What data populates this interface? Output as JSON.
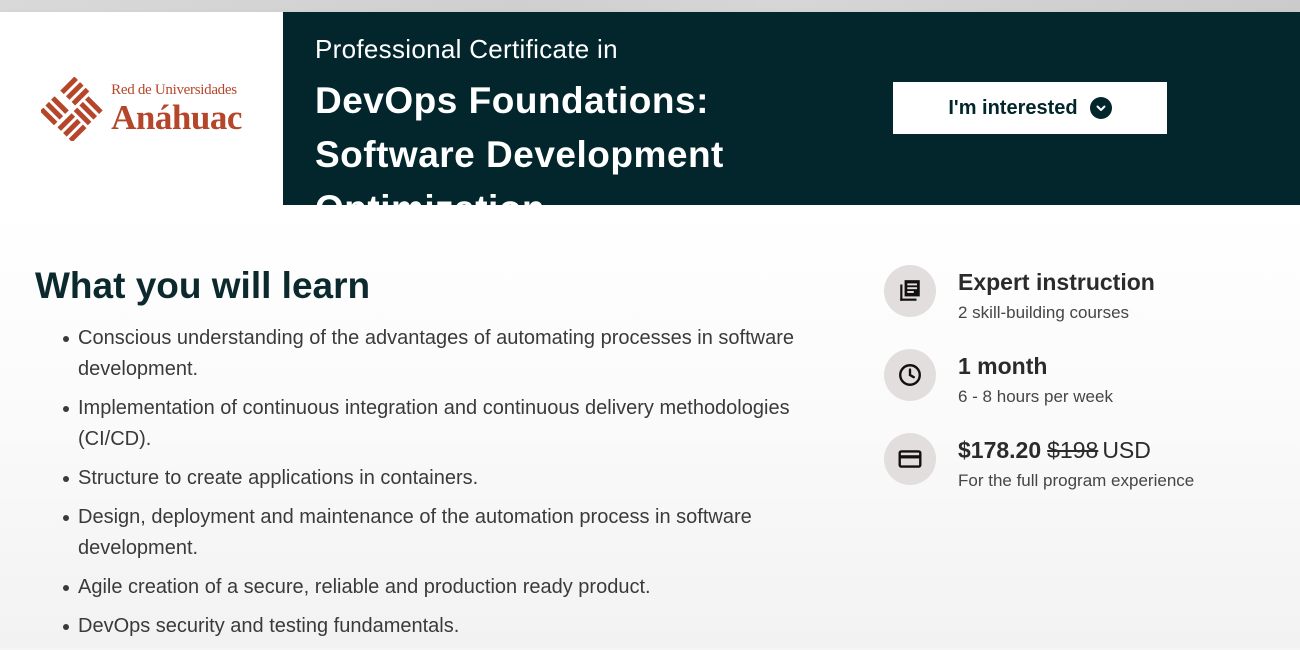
{
  "brand": {
    "line1": "Red de Universidades",
    "line2": "Anáhuac",
    "color": "#b5462a"
  },
  "hero": {
    "pre_title": "Professional Certificate in",
    "title": "DevOps Foundations: Software Development Optimization",
    "cta_label": "I'm interested",
    "cta_icon": "chevron-down-icon",
    "background": "#02262b"
  },
  "learn": {
    "heading": "What you will learn",
    "items": [
      "Conscious understanding of the advantages of automating processes in software development.",
      "Implementation of continuous integration and continuous delivery methodologies (CI/CD).",
      "Structure to create applications in containers.",
      "Design, deployment and maintenance of the automation process in software development.",
      "Agile creation of a secure, reliable and production ready product.",
      "DevOps security and testing fundamentals."
    ]
  },
  "facts": [
    {
      "icon": "courses-icon",
      "title": "Expert instruction",
      "sub": "2 skill-building courses"
    },
    {
      "icon": "clock-icon",
      "title": "1 month",
      "sub": "6 - 8 hours per week"
    },
    {
      "icon": "credit-card-icon",
      "price": "$178.20",
      "old_price": "$198",
      "currency": "USD",
      "sub": "For the full program experience"
    }
  ]
}
